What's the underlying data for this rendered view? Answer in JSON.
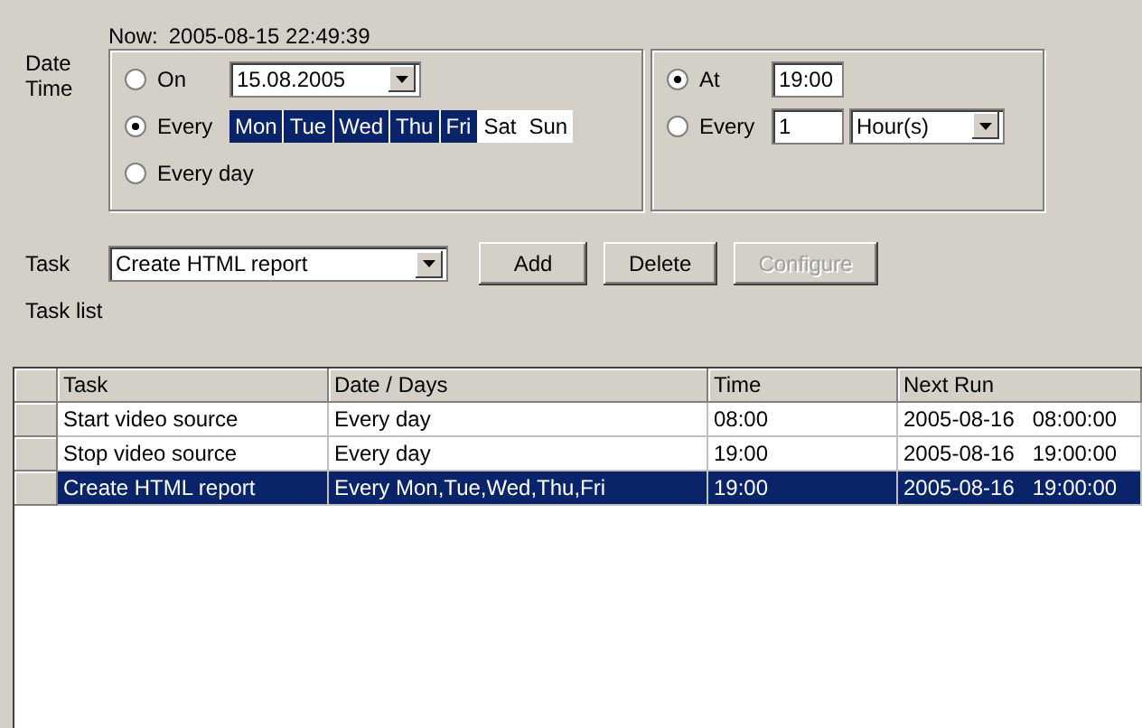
{
  "now": {
    "label": "Now:",
    "value": "2005-08-15   22:49:39"
  },
  "date_time_label": "Date\nTime",
  "date_group": {
    "on": {
      "label": "On",
      "selected": false,
      "date": "15.08.2005"
    },
    "every": {
      "label": "Every",
      "selected": true,
      "days": [
        {
          "label": "Mon",
          "selected": true
        },
        {
          "label": "Tue",
          "selected": true
        },
        {
          "label": "Wed",
          "selected": true
        },
        {
          "label": "Thu",
          "selected": true
        },
        {
          "label": "Fri",
          "selected": true
        },
        {
          "label": "Sat",
          "selected": false
        },
        {
          "label": "Sun",
          "selected": false
        }
      ]
    },
    "every_day": {
      "label": "Every day",
      "selected": false
    }
  },
  "time_group": {
    "at": {
      "label": "At",
      "selected": true,
      "value": "19:00"
    },
    "every": {
      "label": "Every",
      "selected": false,
      "value": "1",
      "unit": "Hour(s)"
    }
  },
  "task": {
    "label": "Task",
    "value": "Create HTML report"
  },
  "buttons": [
    {
      "label": "Add",
      "disabled": false
    },
    {
      "label": "Delete",
      "disabled": false
    },
    {
      "label": "Configure",
      "disabled": true
    }
  ],
  "task_list_label": "Task list",
  "table": {
    "columns": [
      "Task",
      "Date / Days",
      "Time",
      "Next Run"
    ],
    "rows": [
      {
        "cells": [
          "Start video source",
          "Every day",
          "08:00",
          "2005-08-16   08:00:00"
        ],
        "selected": false
      },
      {
        "cells": [
          "Stop video source",
          "Every day",
          "19:00",
          "2005-08-16   19:00:00"
        ],
        "selected": false
      },
      {
        "cells": [
          "Create HTML report",
          "Every Mon,Tue,Wed,Thu,Fri",
          "19:00",
          "2005-08-16   19:00:00"
        ],
        "selected": true
      }
    ]
  }
}
